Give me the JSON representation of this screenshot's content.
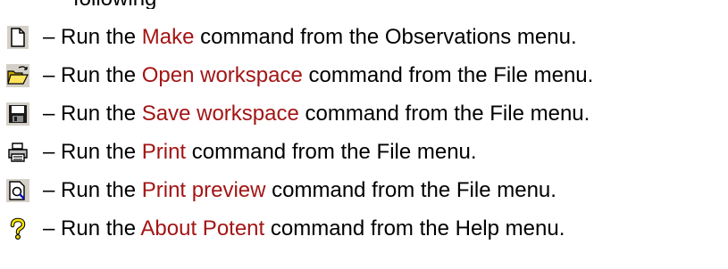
{
  "partial_heading": "following",
  "link_color": "#a31515",
  "rows": [
    {
      "icon": "new-document-icon",
      "dash": "– Run the ",
      "command": "Make",
      "middle": " command from the ",
      "menu": "Observations",
      "tail": " menu."
    },
    {
      "icon": "open-folder-icon",
      "dash": "– Run the ",
      "command": "Open workspace",
      "middle": " command from the ",
      "menu": "File",
      "tail": " menu."
    },
    {
      "icon": "save-disk-icon",
      "dash": "– Run the ",
      "command": "Save workspace",
      "middle": " command from the ",
      "menu": "File",
      "tail": " menu."
    },
    {
      "icon": "printer-icon",
      "dash": "– Run the ",
      "command": "Print",
      "middle": " command from the ",
      "menu": "File",
      "tail": " menu."
    },
    {
      "icon": "print-preview-icon",
      "dash": "– Run the ",
      "command": "Print preview",
      "middle": " command from the ",
      "menu": "File",
      "tail": " menu."
    },
    {
      "icon": "about-help-icon",
      "dash": "– Run the ",
      "command": "About Potent",
      "middle": " command from the ",
      "menu": "Help",
      "tail": " menu."
    }
  ]
}
